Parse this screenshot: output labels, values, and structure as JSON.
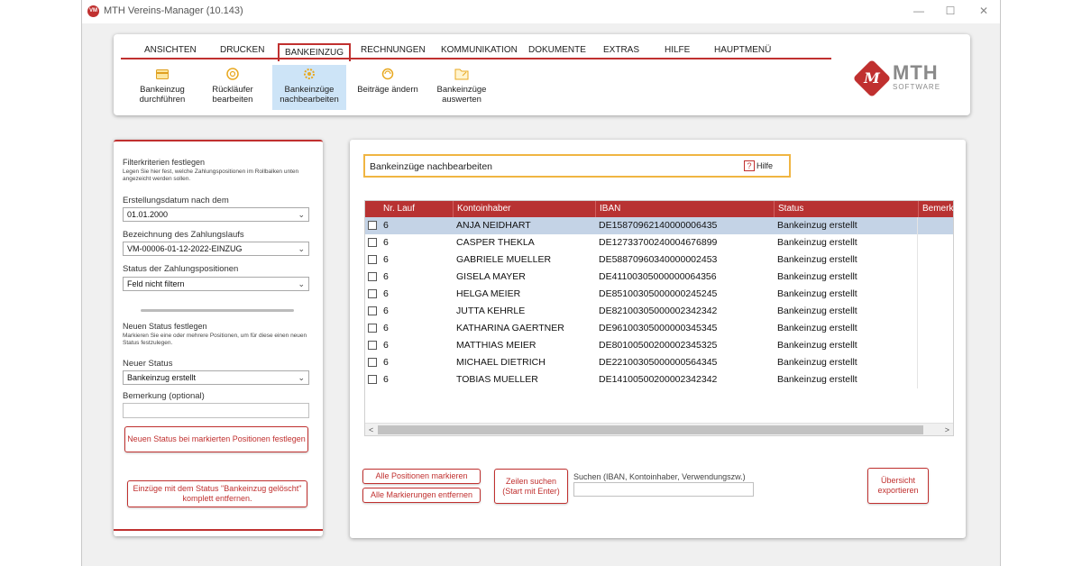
{
  "window": {
    "title": "MTH Vereins-Manager  (10.143)",
    "app_icon_text": "VM",
    "minimize": "—",
    "maximize": "☐",
    "close": "✕"
  },
  "ribbon": {
    "tabs": [
      "ANSICHTEN",
      "DRUCKEN",
      "BANKEINZUG",
      "RECHNUNGEN",
      "KOMMUNIKATION",
      "DOKUMENTE",
      "EXTRAS",
      "HILFE",
      "HAUPTMENÜ"
    ],
    "active_tab": "BANKEINZUG",
    "buttons": [
      {
        "line1": "Bankeinzug",
        "line2": "durchführen",
        "icon": "card-icon"
      },
      {
        "line1": "Rückläufer",
        "line2": "bearbeiten",
        "icon": "circle-arrow-icon"
      },
      {
        "line1": "Bankeinzüge",
        "line2": "nachbearbeiten",
        "icon": "gear-icon"
      },
      {
        "line1": "Beiträge ändern",
        "line2": "",
        "icon": "refresh-icon"
      },
      {
        "line1": "Bankeinzüge",
        "line2": "auswerten",
        "icon": "folder-icon"
      }
    ],
    "logo": {
      "mark": "M",
      "text": "MTH",
      "sub": "SOFTWARE"
    }
  },
  "filter": {
    "heading": "Filterkriterien festlegen",
    "description": "Legen Sie hier fest, welche Zahlungspositionen im Rollbalken unten angezeicht werden sollen.",
    "date_label": "Erstellungsdatum nach dem",
    "date_value": "01.01.2000",
    "run_label": "Bezeichnung des Zahlungslaufs",
    "run_value": "VM-00006-01-12-2022-EINZUG",
    "status_label": "Status der Zahlungspositionen",
    "status_value": "Feld nicht filtern"
  },
  "newstatus": {
    "heading": "Neuen Status festlegen",
    "description": "Markieren Sie eine oder mehrere Positionen, um für diese einen neuen Status festzulegen.",
    "status_label": "Neuer Status",
    "status_value": "Bankeinzug erstellt",
    "comment_label": "Bemerkung (optional)",
    "comment_value": "",
    "apply_button": "Neuen Status bei markierten Positionen festlegen",
    "remove_button": "Einzüge mit dem Status \"Bankeinzug gelöscht\" komplett entfernen."
  },
  "main": {
    "title": "Bankeinzüge nachbearbeiten",
    "help_icon": "?",
    "help_label": "Hilfe",
    "columns": [
      "Nr. Lauf",
      "Kontoinhaber",
      "IBAN",
      "Status",
      "Bemerkung"
    ],
    "rows": [
      {
        "lauf": "6",
        "inhaber": "ANJA NEIDHART",
        "iban": "DE15870962140000006435",
        "status": "Bankeinzug erstellt",
        "selected": true
      },
      {
        "lauf": "6",
        "inhaber": "CASPER THEKLA",
        "iban": "DE12733700240004676899",
        "status": "Bankeinzug erstellt",
        "selected": false
      },
      {
        "lauf": "6",
        "inhaber": "GABRIELE MUELLER",
        "iban": "DE58870960340000002453",
        "status": "Bankeinzug erstellt",
        "selected": false
      },
      {
        "lauf": "6",
        "inhaber": "GISELA MAYER",
        "iban": "DE41100305000000064356",
        "status": "Bankeinzug erstellt",
        "selected": false
      },
      {
        "lauf": "6",
        "inhaber": "HELGA MEIER",
        "iban": "DE85100305000000245245",
        "status": "Bankeinzug erstellt",
        "selected": false
      },
      {
        "lauf": "6",
        "inhaber": "JUTTA KEHRLE",
        "iban": "DE82100305000002342342",
        "status": "Bankeinzug erstellt",
        "selected": false
      },
      {
        "lauf": "6",
        "inhaber": "KATHARINA GAERTNER",
        "iban": "DE96100305000000345345",
        "status": "Bankeinzug erstellt",
        "selected": false
      },
      {
        "lauf": "6",
        "inhaber": "MATTHIAS MEIER",
        "iban": "DE80100500200002345325",
        "status": "Bankeinzug erstellt",
        "selected": false
      },
      {
        "lauf": "6",
        "inhaber": "MICHAEL DIETRICH",
        "iban": "DE22100305000000564345",
        "status": "Bankeinzug erstellt",
        "selected": false
      },
      {
        "lauf": "6",
        "inhaber": "TOBIAS MUELLER",
        "iban": "DE14100500200002342342",
        "status": "Bankeinzug erstellt",
        "selected": false
      }
    ],
    "scroll_left": "<",
    "scroll_right": ">",
    "mark_all": "Alle Positionen markieren",
    "unmark_all": "Alle Markierungen entfernen",
    "search_button": "Zeilen suchen (Start mit Enter)",
    "search_label": "Suchen (IBAN, Kontoinhaber, Verwendungszw.)",
    "search_value": "",
    "export_button": "Übersicht exportieren"
  },
  "colors": {
    "accent": "#c0302f",
    "header_bg": "#b83232",
    "highlight": "#f0b542",
    "selected_row": "#c4d3e6",
    "active_button": "#cde4f7"
  }
}
